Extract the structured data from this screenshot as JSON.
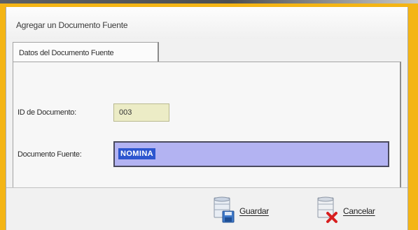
{
  "window": {
    "title": "Agregar un Documento Fuente"
  },
  "tabs": [
    {
      "label": "Datos del Documento Fuente",
      "selected": true
    }
  ],
  "form": {
    "id_label": "ID de Documento:",
    "id_value": "003",
    "doc_label": "Documento Fuente:",
    "doc_value": "NOMINA"
  },
  "buttons": {
    "save_label": "Guardar",
    "cancel_label": "Cancelar"
  },
  "icons": {
    "save": "database-save-icon",
    "cancel": "database-cancel-icon"
  },
  "colors": {
    "frame": "#f4b515",
    "id_field_bg": "#ececc6",
    "doc_field_bg": "#b3b3f2",
    "selection": "#2d56cf"
  }
}
